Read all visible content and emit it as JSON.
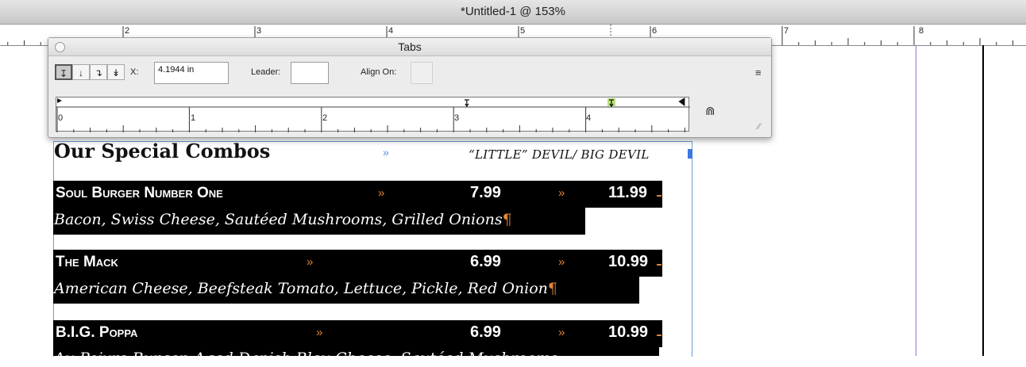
{
  "window": {
    "title": "*Untitled-1 @ 153%"
  },
  "top_ruler": {
    "numbers": [
      "2",
      "3",
      "4",
      "5",
      "6",
      "7",
      "8"
    ]
  },
  "tabs_panel": {
    "title": "Tabs",
    "tab_types": [
      {
        "name": "left-justified-tab",
        "glyph": "↧",
        "active": true
      },
      {
        "name": "center-justified-tab",
        "glyph": "↓",
        "active": false
      },
      {
        "name": "right-justified-tab",
        "glyph": "↴",
        "active": false
      },
      {
        "name": "align-to-decimal-tab",
        "glyph": "↡",
        "active": false
      }
    ],
    "x_label": "X:",
    "x_value": "4.1944 in",
    "leader_label": "Leader:",
    "leader_value": "",
    "align_on_label": "Align On:",
    "align_on_value": "",
    "menu_icon": "≡",
    "ruler_numbers": [
      "0",
      "1",
      "2",
      "3",
      "4"
    ],
    "tab_stop_positions_in": [
      3.1,
      4.1944
    ],
    "right_indent_in": 4.75
  },
  "document": {
    "heading": "Our Special Combos",
    "heading_tab_char": "»",
    "heading_right": "“LITTLE” DEVIL/ BIG DEVIL",
    "items": [
      {
        "name": "Soul Burger Number One",
        "price1": "7.99",
        "price2": "11.99",
        "desc": "Bacon, Swiss Cheese, Sautéed Mushrooms, Grilled Onions"
      },
      {
        "name": "The Mack",
        "price1": "6.99",
        "price2": "10.99",
        "desc": "American Cheese, Beefsteak Tomato, Lettuce, Pickle, Red Onion"
      },
      {
        "name": "B.I.G. Poppa",
        "price1": "6.99",
        "price2": "10.99",
        "desc": "Au Poivre Burger, Aged Danish Bleu Cheese, Sautéed Mushrooms"
      }
    ],
    "tab_char": "»",
    "pilcrow": "¶"
  },
  "colors": {
    "highlight": "#000000",
    "hidden_chars": "#e0843a",
    "frame": "#6f9ad8",
    "guide": "#9a6fd6"
  }
}
